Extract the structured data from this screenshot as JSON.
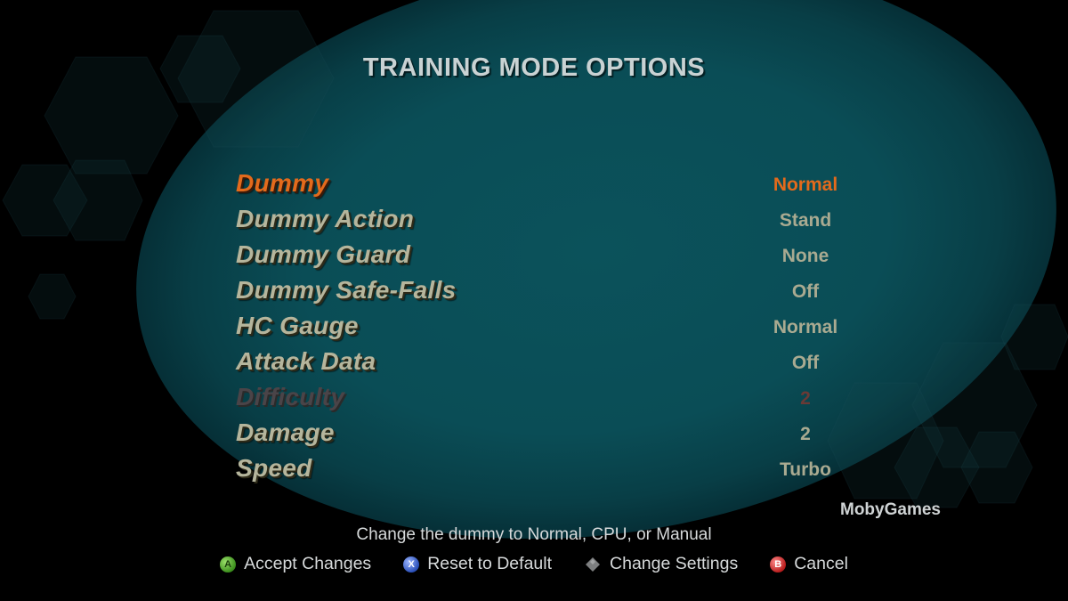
{
  "screen": {
    "title": "TRAINING MODE OPTIONS",
    "watermark": "MobyGames",
    "hint": "Change the dummy to Normal, CPU, or Manual"
  },
  "options": [
    {
      "label": "Dummy",
      "value": "Normal",
      "state": "selected"
    },
    {
      "label": "Dummy Action",
      "value": "Stand",
      "state": "normal"
    },
    {
      "label": "Dummy Guard",
      "value": "None",
      "state": "normal"
    },
    {
      "label": "Dummy Safe-Falls",
      "value": "Off",
      "state": "normal"
    },
    {
      "label": "HC Gauge",
      "value": "Normal",
      "state": "normal"
    },
    {
      "label": "Attack Data",
      "value": "Off",
      "state": "normal"
    },
    {
      "label": "Difficulty",
      "value": "2",
      "state": "disabled"
    },
    {
      "label": "Damage",
      "value": "2",
      "state": "normal"
    },
    {
      "label": "Speed",
      "value": "Turbo",
      "state": "normal"
    }
  ],
  "controls": [
    {
      "button": "A",
      "icon": "a-button-icon",
      "label": "Accept Changes",
      "color": "#4caf2a"
    },
    {
      "button": "X",
      "icon": "x-button-icon",
      "label": "Reset to Default",
      "color": "#2a4fb8"
    },
    {
      "button": "",
      "icon": "dpad-icon",
      "label": "Change Settings",
      "color": "#8a8a8a"
    },
    {
      "button": "B",
      "icon": "b-button-icon",
      "label": "Cancel",
      "color": "#c62020"
    }
  ],
  "colors": {
    "selected": "#e36a1c",
    "option_text": "#b5b59c",
    "background_teal": "#0b525b"
  }
}
